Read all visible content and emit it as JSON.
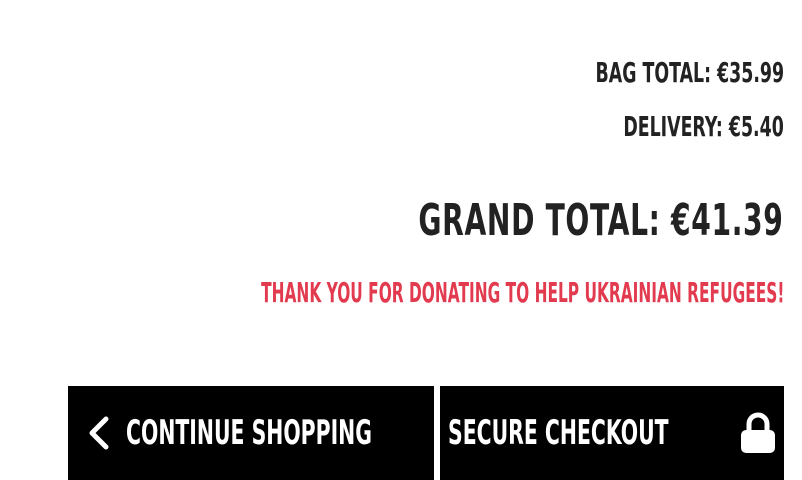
{
  "summary": {
    "bag_total": "BAG TOTAL: €35.99",
    "delivery": "DELIVERY: €5.40",
    "grand_total": "GRAND TOTAL: €41.39",
    "donation_message": "THANK YOU FOR DONATING TO HELP UKRAINIAN REFUGEES!"
  },
  "buttons": {
    "continue_label": "CONTINUE SHOPPING",
    "checkout_label": "SECURE CHECKOUT"
  },
  "icons": {
    "continue": "chevron-left-icon",
    "checkout": "lock-icon"
  },
  "colors": {
    "text": "#222222",
    "accent": "#e23a4e",
    "button_bg": "#000000",
    "button_text": "#ffffff"
  }
}
